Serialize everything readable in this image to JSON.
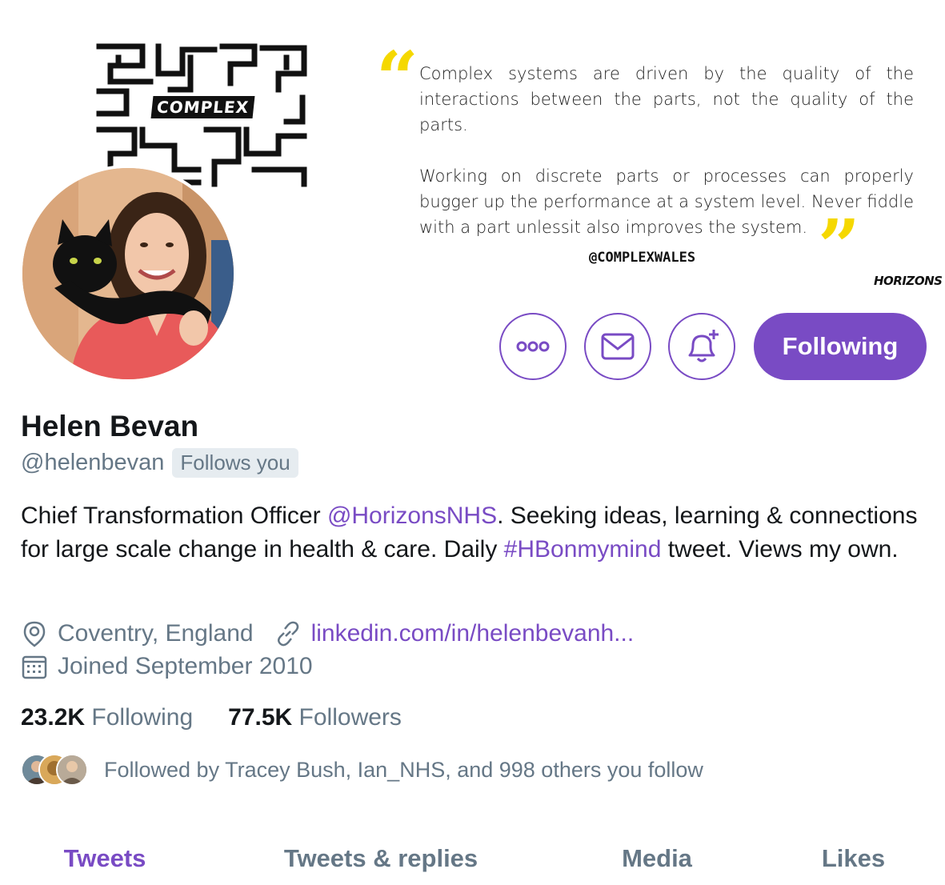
{
  "banner": {
    "maze_label": "COMPLEX",
    "quote_paragraph_1": "Complex systems are driven by the quality of the interactions between the parts, not the quality of the parts.",
    "quote_paragraph_2": "Working on discrete parts or processes can properly bugger up the performance at a system level. Never fiddle with a part unlessit also improves the system.",
    "quote_handle": "@COMPLEXWALES",
    "brand": "HORIZONS",
    "quote_mark_color": "#f5d800"
  },
  "actions": {
    "more_icon": "more-icon",
    "message_icon": "envelope-icon",
    "notify_icon": "bell-plus-icon",
    "follow_label": "Following",
    "accent_color": "#794bc4"
  },
  "profile": {
    "name": "Helen Bevan",
    "handle": "@helenbevan",
    "follows_you": "Follows you",
    "bio": {
      "part1": "Chief Transformation Officer ",
      "mention": "@HorizonsNHS",
      "part2": ". Seeking ideas, learning & connections for large scale change in health & care. Daily ",
      "hashtag": "#HBonmymind",
      "part3": " tweet. Views my own."
    },
    "location": "Coventry, England",
    "website": "linkedin.com/in/helenbevanh...",
    "joined": "Joined September 2010"
  },
  "stats": {
    "following_count": "23.2K",
    "following_label": "Following",
    "followers_count": "77.5K",
    "followers_label": "Followers"
  },
  "followed_by": "Followed by Tracey Bush, Ian_NHS, and 998 others you follow",
  "tabs": [
    {
      "label": "Tweets",
      "active": true
    },
    {
      "label": "Tweets & replies",
      "active": false
    },
    {
      "label": "Media",
      "active": false
    },
    {
      "label": "Likes",
      "active": false
    }
  ]
}
